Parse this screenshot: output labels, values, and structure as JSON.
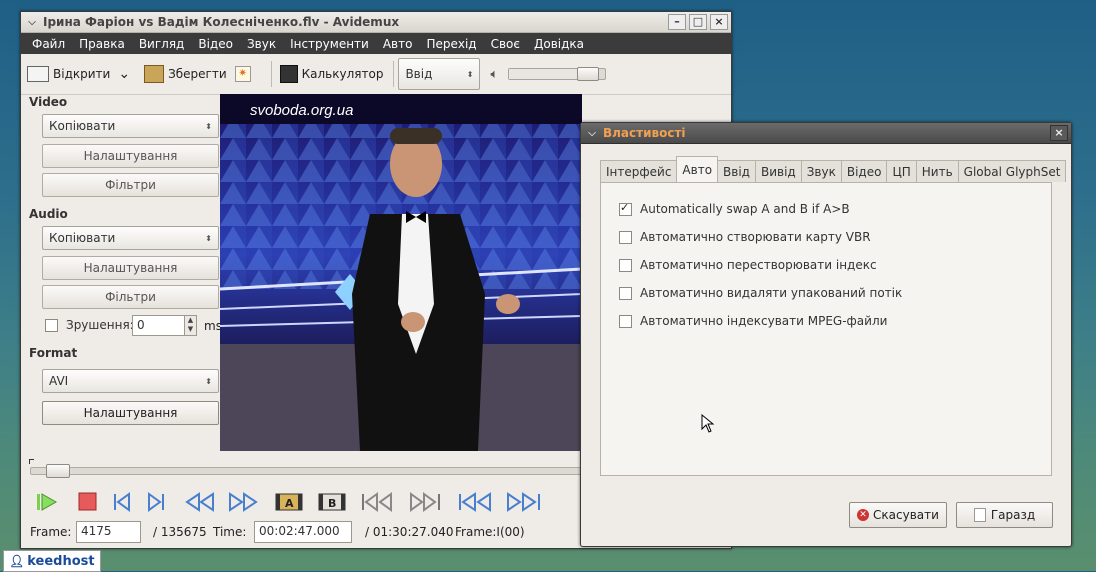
{
  "main_window": {
    "title": "Ірина Фаріон vs Вадім Колесніченко.flv - Avidemux",
    "controls": [
      "–",
      "□",
      "×"
    ]
  },
  "menu": [
    "Файл",
    "Правка",
    "Вигляд",
    "Відео",
    "Звук",
    "Інструменти",
    "Авто",
    "Перехід",
    "Своє",
    "Довідка"
  ],
  "toolbar": {
    "open": "Відкрити",
    "open_menu_arrow": "⌄",
    "save": "Зберегти",
    "calculator": "Калькулятор",
    "view_combo": "Ввід",
    "volume_level": 0.9
  },
  "left_panel": {
    "video_title": "Video",
    "video_codec": "Копіювати",
    "video_settings": "Налаштування",
    "video_filters": "Фільтри",
    "audio_title": "Audio",
    "audio_codec": "Копіювати",
    "audio_settings": "Налаштування",
    "audio_filters": "Фільтри",
    "shift_label": "Зрушення:",
    "shift_value": "0",
    "shift_unit": "ms",
    "format_title": "Format",
    "format_value": "AVI",
    "format_settings": "Налаштування"
  },
  "video_frame": {
    "watermark": "svoboda.org.ua"
  },
  "status": {
    "frame_label": "Frame:",
    "frame_value": "4175",
    "frame_total": "/ 135675",
    "time_label": "Time:",
    "time_value": "00:02:47.000",
    "time_total": "/ 01:30:27.040",
    "frame_type": "Frame:I(00)"
  },
  "dialog": {
    "title": "Властивості",
    "tabs": [
      "Інтерфейс",
      "Авто",
      "Ввід",
      "Вивід",
      "Звук",
      "Відео",
      "ЦП",
      "Нить",
      "Global GlyphSet"
    ],
    "active_tab": "Авто",
    "options": [
      {
        "label": "Automatically swap A and B if A>B",
        "checked": true
      },
      {
        "label": "Автоматично створювати карту VBR",
        "checked": false
      },
      {
        "label": "Автоматично перестворювати індекс",
        "checked": false
      },
      {
        "label": "Автоматично видаляти упакований потік",
        "checked": false
      },
      {
        "label": "Автоматично індексувати MPEG-файли",
        "checked": false
      }
    ],
    "cancel": "Скасувати",
    "ok": "Гаразд"
  },
  "taskbar": {
    "logo": "keedhost"
  }
}
